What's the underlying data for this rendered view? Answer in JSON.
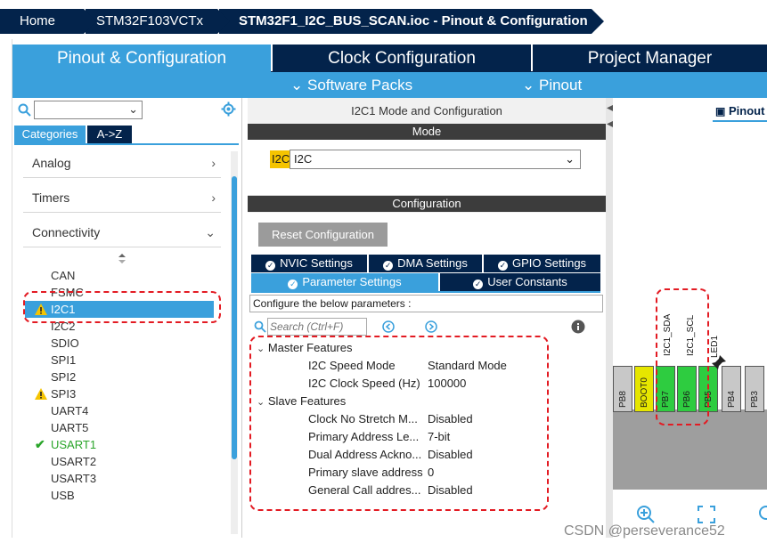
{
  "breadcrumb": {
    "items": [
      "Home",
      "STM32F103VCTx",
      "STM32F1_I2C_BUS_SCAN.ioc - Pinout & Configuration"
    ]
  },
  "main_tabs": {
    "items": [
      {
        "label": "Pinout & Configuration",
        "active": true
      },
      {
        "label": "Clock Configuration",
        "active": false
      },
      {
        "label": "Project Manager",
        "active": false
      }
    ],
    "software_packs": "Software Packs",
    "pinout": "Pinout"
  },
  "left_panel": {
    "search_value": "",
    "tab_categories": "Categories",
    "tab_az": "A->Z",
    "categories": [
      {
        "label": "Analog",
        "chevron": "›"
      },
      {
        "label": "Timers",
        "chevron": "›"
      },
      {
        "label": "Connectivity",
        "chevron": "⌄"
      }
    ],
    "peripherals": [
      {
        "label": "CAN",
        "status": "none"
      },
      {
        "label": "FSMC",
        "status": "none"
      },
      {
        "label": "I2C1",
        "status": "warning",
        "selected": true
      },
      {
        "label": "I2C2",
        "status": "none"
      },
      {
        "label": "SDIO",
        "status": "none"
      },
      {
        "label": "SPI1",
        "status": "none"
      },
      {
        "label": "SPI2",
        "status": "none"
      },
      {
        "label": "SPI3",
        "status": "warning"
      },
      {
        "label": "UART4",
        "status": "none"
      },
      {
        "label": "UART5",
        "status": "none"
      },
      {
        "label": "USART1",
        "status": "ok"
      },
      {
        "label": "USART2",
        "status": "none"
      },
      {
        "label": "USART3",
        "status": "none"
      },
      {
        "label": "USB",
        "status": "none"
      }
    ]
  },
  "mid_panel": {
    "title": "I2C1 Mode and Configuration",
    "mode_header": "Mode",
    "mode_label": "I2C",
    "mode_value": "I2C",
    "config_header": "Configuration",
    "reset_button": "Reset Configuration",
    "tabs_row1": [
      "NVIC Settings",
      "DMA Settings",
      "GPIO Settings"
    ],
    "tabs_row2": [
      "Parameter Settings",
      "User Constants"
    ],
    "configure_text": "Configure the below parameters :",
    "search_placeholder": "Search (Ctrl+F)",
    "groups": [
      {
        "name": "Master Features",
        "params": [
          {
            "name": "I2C Speed Mode",
            "value": "Standard Mode"
          },
          {
            "name": "I2C Clock Speed (Hz)",
            "value": "100000"
          }
        ]
      },
      {
        "name": "Slave Features",
        "params": [
          {
            "name": "Clock No Stretch M...",
            "value": "Disabled"
          },
          {
            "name": "Primary Address Le...",
            "value": "7-bit"
          },
          {
            "name": "Dual Address Ackno...",
            "value": "Disabled"
          },
          {
            "name": "Primary slave address",
            "value": "0"
          },
          {
            "name": "General Call addres...",
            "value": "Disabled"
          }
        ]
      }
    ]
  },
  "right_panel": {
    "tab_label": "Pinout view",
    "pins": [
      {
        "label": "PB8",
        "color": "#c8c8c8"
      },
      {
        "label": "BOOT0",
        "color": "#e6e600"
      },
      {
        "label": "PB7",
        "color": "#2ecc40"
      },
      {
        "label": "PB6",
        "color": "#2ecc40"
      },
      {
        "label": "PB5",
        "color": "#2ecc40"
      },
      {
        "label": "PB4",
        "color": "#c8c8c8"
      },
      {
        "label": "PB3",
        "color": "#c8c8c8"
      }
    ],
    "signals": [
      "I2C1_SDA",
      "I2C1_SCL",
      "LED1"
    ]
  },
  "watermark": "CSDN @perseverance52",
  "colors": {
    "navy": "#03234b",
    "accent_blue": "#3aa0dc",
    "highlight_red": "#e31b23",
    "warning_yellow": "#f5c400",
    "ok_green": "#2aa52a"
  }
}
